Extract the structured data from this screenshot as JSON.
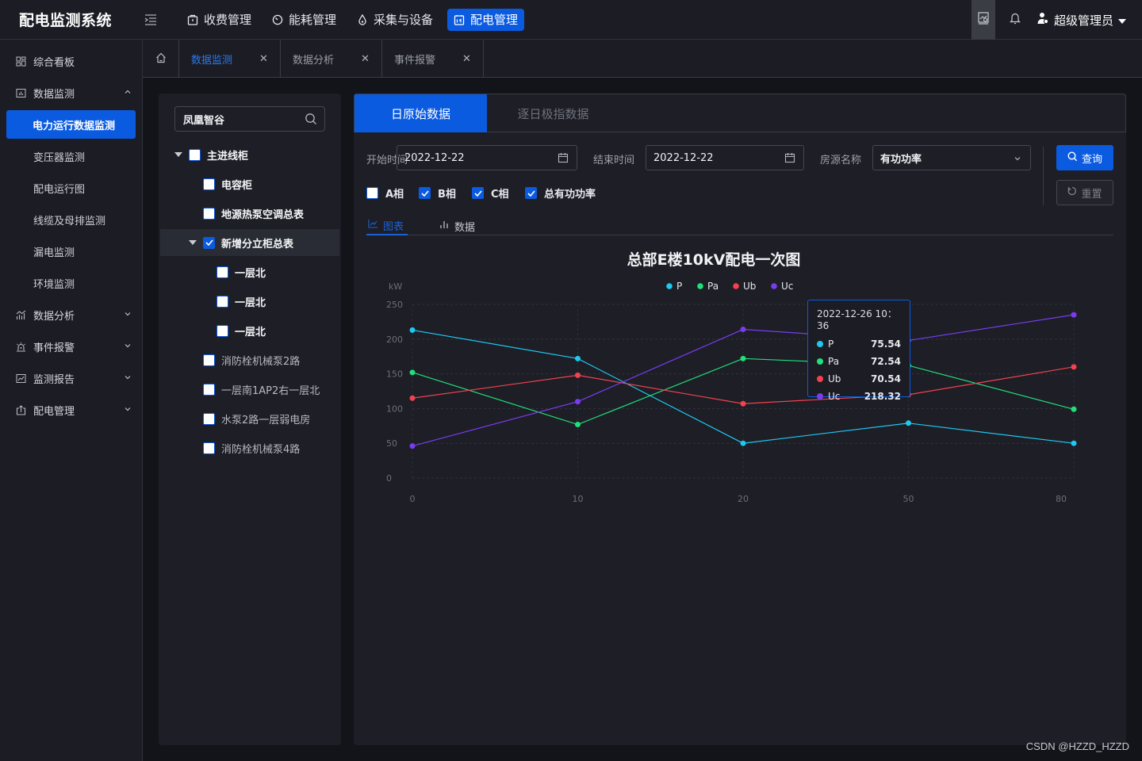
{
  "app": {
    "title": "配电监测系统",
    "top_nav": [
      {
        "label": "收费管理",
        "icon": "wallet-icon",
        "active": false
      },
      {
        "label": "能耗管理",
        "icon": "gauge-icon",
        "active": false
      },
      {
        "label": "采集与设备",
        "icon": "drop-icon",
        "active": false
      },
      {
        "label": "配电管理",
        "icon": "calendar-board-icon",
        "active": true
      }
    ],
    "user": {
      "name": "超级管理员"
    }
  },
  "sidebar": {
    "items": [
      {
        "label": "综合看板",
        "icon": "dashboard-icon",
        "expandable": false
      },
      {
        "label": "数据监测",
        "icon": "bar-chart-icon",
        "expandable": true,
        "expanded": true,
        "children": [
          {
            "label": "电力运行数据监测",
            "active": true
          },
          {
            "label": "变压器监测",
            "active": false
          },
          {
            "label": "配电运行图",
            "active": false
          },
          {
            "label": "线缆及母排监测",
            "active": false
          },
          {
            "label": "漏电监测",
            "active": false
          },
          {
            "label": "环境监测",
            "active": false
          }
        ]
      },
      {
        "label": "数据分析",
        "icon": "analysis-icon",
        "expandable": true,
        "expanded": false
      },
      {
        "label": "事件报警",
        "icon": "alarm-icon",
        "expandable": true,
        "expanded": false
      },
      {
        "label": "监测报告",
        "icon": "report-icon",
        "expandable": true,
        "expanded": false
      },
      {
        "label": "配电管理",
        "icon": "upload-box-icon",
        "expandable": true,
        "expanded": false
      }
    ]
  },
  "tabs": [
    {
      "label": "数据监测",
      "active": true
    },
    {
      "label": "数据分析",
      "active": false
    },
    {
      "label": "事件报警",
      "active": false
    }
  ],
  "tree": {
    "search_value": "凤凰智谷",
    "nodes": [
      {
        "label": "主进线柜",
        "level": 0,
        "expanded": true,
        "checked": false
      },
      {
        "label": "电容柜",
        "level": 1,
        "checked": false
      },
      {
        "label": "地源热泵空调总表",
        "level": 1,
        "checked": false
      },
      {
        "label": "新增分立柜总表",
        "level": 1,
        "expanded": true,
        "checked": true,
        "highlighted": true
      },
      {
        "label": "一层北",
        "level": 2,
        "checked": false
      },
      {
        "label": "一层北",
        "level": 2,
        "checked": false
      },
      {
        "label": "一层北",
        "level": 2,
        "checked": false
      },
      {
        "label": "消防栓机械泵2路",
        "level": 1,
        "checked": false
      },
      {
        "label": "一层南1AP2右一层北",
        "level": 1,
        "checked": false
      },
      {
        "label": "水泵2路一层弱电房",
        "level": 1,
        "checked": false
      },
      {
        "label": "消防栓机械泵4路",
        "level": 1,
        "checked": false
      }
    ]
  },
  "main": {
    "tabs": [
      {
        "label": "日原始数据",
        "active": true
      },
      {
        "label": "逐日极指数据",
        "active": false
      }
    ],
    "filters": {
      "start_label": "开始时间",
      "start_value": "2022-12-22",
      "end_label": "结束时间",
      "end_value": "2022-12-22",
      "room_label": "房源名称",
      "room_value": "有功功率",
      "query_label": "查询",
      "reset_label": "重置"
    },
    "phases": [
      {
        "label": "A相",
        "checked": false
      },
      {
        "label": "B相",
        "checked": true
      },
      {
        "label": "C相",
        "checked": true
      },
      {
        "label": "总有功功率",
        "checked": true
      }
    ],
    "view_tabs": [
      {
        "label": "图表",
        "active": true
      },
      {
        "label": "数据",
        "active": false
      }
    ]
  },
  "chart_data": {
    "type": "line",
    "title": "总部E楼10kV配电一次图",
    "xlabel": "",
    "ylabel": "kW",
    "categories": [
      "0",
      "10",
      "20",
      "50",
      "80"
    ],
    "ylim": [
      0,
      250
    ],
    "yticks": [
      0,
      50,
      100,
      150,
      200,
      250
    ],
    "grid": true,
    "legend_position": "top-center",
    "series": [
      {
        "name": "P",
        "color": "#1ec8f0",
        "values": [
          213,
          172,
          50,
          79,
          50
        ]
      },
      {
        "name": "Pa",
        "color": "#20e07a",
        "values": [
          152,
          77,
          172,
          162,
          99
        ]
      },
      {
        "name": "Ub",
        "color": "#f2424f",
        "values": [
          115,
          148,
          107,
          120,
          160
        ]
      },
      {
        "name": "Uc",
        "color": "#7a3cf0",
        "values": [
          46,
          110,
          214,
          198,
          235
        ]
      }
    ],
    "tooltip": {
      "time": "2022-12-26  10：36",
      "rows": [
        {
          "name": "P",
          "value": "75.54",
          "color": "#1ec8f0"
        },
        {
          "name": "Pa",
          "value": "72.54",
          "color": "#20e07a"
        },
        {
          "name": "Ub",
          "value": "70.54",
          "color": "#f2424f"
        },
        {
          "name": "Uc",
          "value": "218.32",
          "color": "#7a3cf0"
        }
      ]
    }
  },
  "watermark": "CSDN @HZZD_HZZD"
}
